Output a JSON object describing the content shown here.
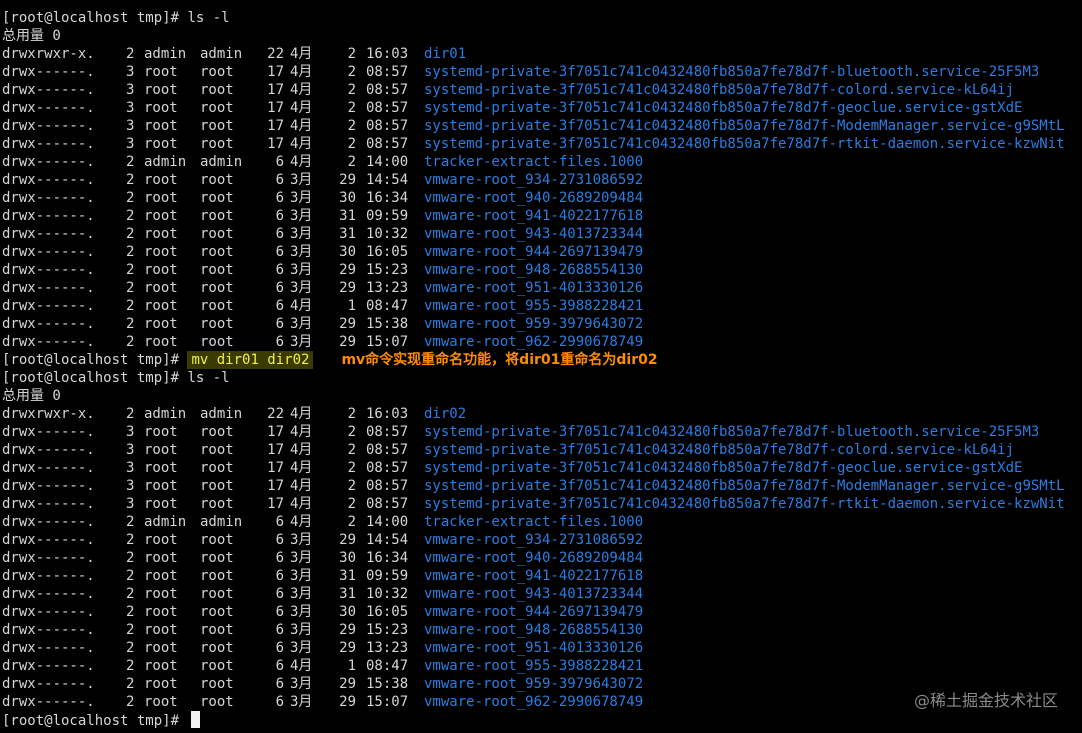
{
  "terminal": {
    "block1": {
      "prompt": "[root@localhost tmp]# ",
      "command": "ls -l",
      "total": "总用量 0",
      "entries": [
        {
          "perm": "drwxrwxr-x.",
          "links": "2",
          "owner": "admin",
          "group": "admin",
          "size": "22",
          "month": "4月",
          "day": "2",
          "time": "16:03",
          "name": "dir01"
        },
        {
          "perm": "drwx------.",
          "links": "3",
          "owner": "root",
          "group": "root",
          "size": "17",
          "month": "4月",
          "day": "2",
          "time": "08:57",
          "name": "systemd-private-3f7051c741c0432480fb850a7fe78d7f-bluetooth.service-25F5M3"
        },
        {
          "perm": "drwx------.",
          "links": "3",
          "owner": "root",
          "group": "root",
          "size": "17",
          "month": "4月",
          "day": "2",
          "time": "08:57",
          "name": "systemd-private-3f7051c741c0432480fb850a7fe78d7f-colord.service-kL64ij"
        },
        {
          "perm": "drwx------.",
          "links": "3",
          "owner": "root",
          "group": "root",
          "size": "17",
          "month": "4月",
          "day": "2",
          "time": "08:57",
          "name": "systemd-private-3f7051c741c0432480fb850a7fe78d7f-geoclue.service-gstXdE"
        },
        {
          "perm": "drwx------.",
          "links": "3",
          "owner": "root",
          "group": "root",
          "size": "17",
          "month": "4月",
          "day": "2",
          "time": "08:57",
          "name": "systemd-private-3f7051c741c0432480fb850a7fe78d7f-ModemManager.service-g9SMtL"
        },
        {
          "perm": "drwx------.",
          "links": "3",
          "owner": "root",
          "group": "root",
          "size": "17",
          "month": "4月",
          "day": "2",
          "time": "08:57",
          "name": "systemd-private-3f7051c741c0432480fb850a7fe78d7f-rtkit-daemon.service-kzwNit"
        },
        {
          "perm": "drwx------.",
          "links": "2",
          "owner": "admin",
          "group": "admin",
          "size": "6",
          "month": "4月",
          "day": "2",
          "time": "14:00",
          "name": "tracker-extract-files.1000"
        },
        {
          "perm": "drwx------.",
          "links": "2",
          "owner": "root",
          "group": "root",
          "size": "6",
          "month": "3月",
          "day": "29",
          "time": "14:54",
          "name": "vmware-root_934-2731086592"
        },
        {
          "perm": "drwx------.",
          "links": "2",
          "owner": "root",
          "group": "root",
          "size": "6",
          "month": "3月",
          "day": "30",
          "time": "16:34",
          "name": "vmware-root_940-2689209484"
        },
        {
          "perm": "drwx------.",
          "links": "2",
          "owner": "root",
          "group": "root",
          "size": "6",
          "month": "3月",
          "day": "31",
          "time": "09:59",
          "name": "vmware-root_941-4022177618"
        },
        {
          "perm": "drwx------.",
          "links": "2",
          "owner": "root",
          "group": "root",
          "size": "6",
          "month": "3月",
          "day": "31",
          "time": "10:32",
          "name": "vmware-root_943-4013723344"
        },
        {
          "perm": "drwx------.",
          "links": "2",
          "owner": "root",
          "group": "root",
          "size": "6",
          "month": "3月",
          "day": "30",
          "time": "16:05",
          "name": "vmware-root_944-2697139479"
        },
        {
          "perm": "drwx------.",
          "links": "2",
          "owner": "root",
          "group": "root",
          "size": "6",
          "month": "3月",
          "day": "29",
          "time": "15:23",
          "name": "vmware-root_948-2688554130"
        },
        {
          "perm": "drwx------.",
          "links": "2",
          "owner": "root",
          "group": "root",
          "size": "6",
          "month": "3月",
          "day": "29",
          "time": "13:23",
          "name": "vmware-root_951-4013330126"
        },
        {
          "perm": "drwx------.",
          "links": "2",
          "owner": "root",
          "group": "root",
          "size": "6",
          "month": "4月",
          "day": "1",
          "time": "08:47",
          "name": "vmware-root_955-3988228421"
        },
        {
          "perm": "drwx------.",
          "links": "2",
          "owner": "root",
          "group": "root",
          "size": "6",
          "month": "3月",
          "day": "29",
          "time": "15:38",
          "name": "vmware-root_959-3979643072"
        },
        {
          "perm": "drwx------.",
          "links": "2",
          "owner": "root",
          "group": "root",
          "size": "6",
          "month": "3月",
          "day": "29",
          "time": "15:07",
          "name": "vmware-root_962-2990678749"
        }
      ]
    },
    "mv_line": {
      "prompt": "[root@localhost tmp]# ",
      "command": "mv dir01 dir02",
      "annotation": "mv命令实现重命名功能，将dir01重命名为dir02"
    },
    "block2": {
      "prompt": "[root@localhost tmp]# ",
      "command": "ls -l",
      "total": "总用量 0",
      "entries": [
        {
          "perm": "drwxrwxr-x.",
          "links": "2",
          "owner": "admin",
          "group": "admin",
          "size": "22",
          "month": "4月",
          "day": "2",
          "time": "16:03",
          "name": "dir02"
        },
        {
          "perm": "drwx------.",
          "links": "3",
          "owner": "root",
          "group": "root",
          "size": "17",
          "month": "4月",
          "day": "2",
          "time": "08:57",
          "name": "systemd-private-3f7051c741c0432480fb850a7fe78d7f-bluetooth.service-25F5M3"
        },
        {
          "perm": "drwx------.",
          "links": "3",
          "owner": "root",
          "group": "root",
          "size": "17",
          "month": "4月",
          "day": "2",
          "time": "08:57",
          "name": "systemd-private-3f7051c741c0432480fb850a7fe78d7f-colord.service-kL64ij"
        },
        {
          "perm": "drwx------.",
          "links": "3",
          "owner": "root",
          "group": "root",
          "size": "17",
          "month": "4月",
          "day": "2",
          "time": "08:57",
          "name": "systemd-private-3f7051c741c0432480fb850a7fe78d7f-geoclue.service-gstXdE"
        },
        {
          "perm": "drwx------.",
          "links": "3",
          "owner": "root",
          "group": "root",
          "size": "17",
          "month": "4月",
          "day": "2",
          "time": "08:57",
          "name": "systemd-private-3f7051c741c0432480fb850a7fe78d7f-ModemManager.service-g9SMtL"
        },
        {
          "perm": "drwx------.",
          "links": "3",
          "owner": "root",
          "group": "root",
          "size": "17",
          "month": "4月",
          "day": "2",
          "time": "08:57",
          "name": "systemd-private-3f7051c741c0432480fb850a7fe78d7f-rtkit-daemon.service-kzwNit"
        },
        {
          "perm": "drwx------.",
          "links": "2",
          "owner": "admin",
          "group": "admin",
          "size": "6",
          "month": "4月",
          "day": "2",
          "time": "14:00",
          "name": "tracker-extract-files.1000"
        },
        {
          "perm": "drwx------.",
          "links": "2",
          "owner": "root",
          "group": "root",
          "size": "6",
          "month": "3月",
          "day": "29",
          "time": "14:54",
          "name": "vmware-root_934-2731086592"
        },
        {
          "perm": "drwx------.",
          "links": "2",
          "owner": "root",
          "group": "root",
          "size": "6",
          "month": "3月",
          "day": "30",
          "time": "16:34",
          "name": "vmware-root_940-2689209484"
        },
        {
          "perm": "drwx------.",
          "links": "2",
          "owner": "root",
          "group": "root",
          "size": "6",
          "month": "3月",
          "day": "31",
          "time": "09:59",
          "name": "vmware-root_941-4022177618"
        },
        {
          "perm": "drwx------.",
          "links": "2",
          "owner": "root",
          "group": "root",
          "size": "6",
          "month": "3月",
          "day": "31",
          "time": "10:32",
          "name": "vmware-root_943-4013723344"
        },
        {
          "perm": "drwx------.",
          "links": "2",
          "owner": "root",
          "group": "root",
          "size": "6",
          "month": "3月",
          "day": "30",
          "time": "16:05",
          "name": "vmware-root_944-2697139479"
        },
        {
          "perm": "drwx------.",
          "links": "2",
          "owner": "root",
          "group": "root",
          "size": "6",
          "month": "3月",
          "day": "29",
          "time": "15:23",
          "name": "vmware-root_948-2688554130"
        },
        {
          "perm": "drwx------.",
          "links": "2",
          "owner": "root",
          "group": "root",
          "size": "6",
          "month": "3月",
          "day": "29",
          "time": "13:23",
          "name": "vmware-root_951-4013330126"
        },
        {
          "perm": "drwx------.",
          "links": "2",
          "owner": "root",
          "group": "root",
          "size": "6",
          "month": "4月",
          "day": "1",
          "time": "08:47",
          "name": "vmware-root_955-3988228421"
        },
        {
          "perm": "drwx------.",
          "links": "2",
          "owner": "root",
          "group": "root",
          "size": "6",
          "month": "3月",
          "day": "29",
          "time": "15:38",
          "name": "vmware-root_959-3979643072"
        },
        {
          "perm": "drwx------.",
          "links": "2",
          "owner": "root",
          "group": "root",
          "size": "6",
          "month": "3月",
          "day": "29",
          "time": "15:07",
          "name": "vmware-root_962-2990678749"
        }
      ]
    },
    "final_prompt": "[root@localhost tmp]# "
  },
  "watermark": "@稀土掘金技术社区",
  "colors": {
    "background": "#000000",
    "text": "#d6d6d6",
    "directory": "#2a7de1",
    "command_highlight": "#f0f04a",
    "annotation": "#ff8c00"
  }
}
